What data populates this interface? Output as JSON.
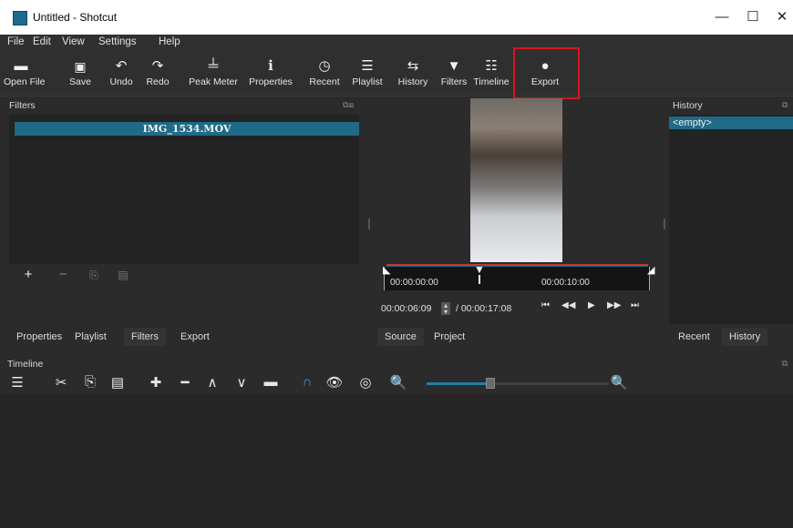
{
  "window": {
    "title": "Untitled - Shotcut",
    "minimize": "—",
    "maximize": "☐",
    "close": "✕"
  },
  "menu": [
    "File",
    "Edit",
    "View",
    "Settings",
    "Help"
  ],
  "toolbar": [
    {
      "label": "Open File",
      "icon": "▬"
    },
    {
      "label": "Save",
      "icon": "💾"
    },
    {
      "label": "Undo",
      "icon": "↶"
    },
    {
      "label": "Redo",
      "icon": "↷"
    },
    {
      "label": "Peak Meter",
      "icon": "╧"
    },
    {
      "label": "Properties",
      "icon": "ℹ"
    },
    {
      "label": "Recent",
      "icon": "◷"
    },
    {
      "label": "Playlist",
      "icon": "☰"
    },
    {
      "label": "History",
      "icon": "⇆"
    },
    {
      "label": "Filters",
      "icon": "▼"
    },
    {
      "label": "Timeline",
      "icon": "☷"
    },
    {
      "label": "Export",
      "icon": "●"
    }
  ],
  "filters_panel": {
    "header": "Filters",
    "clip_name": "IMG_1534.MOV",
    "buttons": {
      "add": "+",
      "remove": "−",
      "copy": "⎘",
      "paste": "▤"
    }
  },
  "left_tabs": [
    "Properties",
    "Playlist",
    "Filters",
    "Export"
  ],
  "player": {
    "scrub_start": "00:00:00:00",
    "scrub_mark": "00:00:10:00",
    "current_time": "00:00:06:09",
    "total_time": "/ 00:00:17:08",
    "tabs": [
      "Source",
      "Project"
    ],
    "transport": {
      "skip_start": "⏮",
      "rewind": "◀◀",
      "play": "▶",
      "forward": "▶▶",
      "skip_end": "⏭"
    }
  },
  "history_panel": {
    "header": "History",
    "items": [
      "<empty>"
    ],
    "tabs": [
      "Recent",
      "History"
    ]
  },
  "timeline": {
    "header": "Timeline",
    "tools": [
      "☰",
      "✂",
      "⎘",
      "▤",
      "✚",
      "━",
      "∧",
      "∨",
      "▬",
      "∩",
      "👁",
      "◎",
      "🔍"
    ],
    "zoom_in": "🔍",
    "zoom_level": 0.35
  }
}
